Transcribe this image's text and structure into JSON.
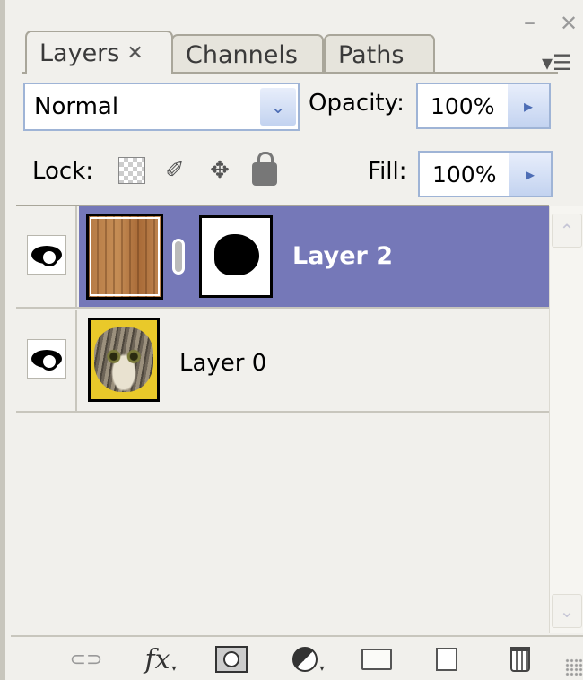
{
  "window": {
    "minimize_glyph": "–",
    "close_glyph": "✕"
  },
  "tabs": [
    {
      "label": "Layers",
      "active": true,
      "close_glyph": "✕"
    },
    {
      "label": "Channels",
      "active": false
    },
    {
      "label": "Paths",
      "active": false
    }
  ],
  "panel_menu_glyph": "▾☰",
  "blend": {
    "mode": "Normal",
    "arrow": "⌄"
  },
  "opacity": {
    "label": "Opacity:",
    "value": "100%",
    "arrow": "▸"
  },
  "lock": {
    "label": "Lock:",
    "move_glyph": "✥",
    "brush_glyph": "✐"
  },
  "fill": {
    "label": "Fill:",
    "value": "100%",
    "arrow": "▸"
  },
  "layers": [
    {
      "name": "Layer 2",
      "selected": true,
      "visible": true,
      "has_mask": true
    },
    {
      "name": "Layer 0",
      "selected": false,
      "visible": true,
      "has_mask": false
    }
  ],
  "scrollbar": {
    "up": "⌃",
    "down": "⌄"
  },
  "toolbar": {
    "link_glyph": "⊂⊃",
    "fx_label": "fx",
    "dropdown_glyph": "▾"
  },
  "colors": {
    "selected_row": "#7578b8",
    "panel_bg": "#f1f0ec",
    "field_border": "#9fb4d6"
  }
}
